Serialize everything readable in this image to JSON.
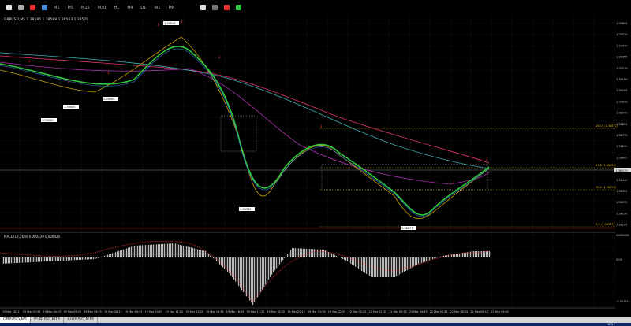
{
  "toolbar": {
    "timeframes": [
      "M1",
      "M5",
      "M15",
      "M30",
      "H1",
      "H4",
      "D1",
      "W1",
      "MN"
    ],
    "colors": {
      "green": "#2ecc40",
      "red": "#e33",
      "yellow": "#ffd700"
    }
  },
  "chart": {
    "header": "GBPUSD,M5  1.38585 1.38589 1.38563 1.38570",
    "price_labels": [
      "1.39605",
      "1.39520",
      "1.39440",
      "1.39355",
      "1.39270",
      "1.39190",
      "1.39105",
      "1.39020",
      "1.38940",
      "1.38855",
      "1.38770",
      "1.38690",
      "1.38605",
      "1.38520",
      "1.38440",
      "1.38355",
      "1.38270",
      "1.38190",
      "1.38105"
    ],
    "current_price": "1.38570",
    "time_labels": [
      "19 Mar 2021",
      "19 Mar 02:55",
      "19 Mar 04:15",
      "19 Mar 05:35",
      "19 Mar 06:55",
      "19 Mar 08:15",
      "19 Mar 09:35",
      "19 Mar 10:55",
      "19 Mar 12:15",
      "19 Mar 13:35",
      "19 Mar 14:55",
      "19 Mar 16:15",
      "19 Mar 17:35",
      "19 Mar 18:55",
      "19 Mar 20:15",
      "19 Mar 21:35",
      "19 Mar 22:55",
      "22 Mar 00:15",
      "22 Mar 01:35",
      "22 Mar 02:55",
      "22 Mar 04:15",
      "22 Mar 05:35",
      "22 Mar 06:55",
      "22 Mar 08:15",
      "22 Mar 09:40"
    ],
    "annotations": [
      "1.39528",
      "1.39005",
      "1.39095",
      "1.39000",
      "1.38330",
      "1.38177"
    ],
    "fib_labels": [
      "100.0 (1.38871)",
      "61.8 (1.38593)",
      "38.2 (1.38453)",
      "0.0 (1.38177)"
    ],
    "macd_label": "MACD(12,26,9) 0.000429 0.000420",
    "macd_ticks": [
      "0.001086",
      "0.00",
      "-0.001541"
    ]
  },
  "tabs": [
    {
      "label": "GBPUSD,M5",
      "active": true
    },
    {
      "label": "EURUSD,M15",
      "active": false
    },
    {
      "label": "AUDUSD,M15",
      "active": false
    }
  ],
  "status": {
    "time": "16:57"
  }
}
